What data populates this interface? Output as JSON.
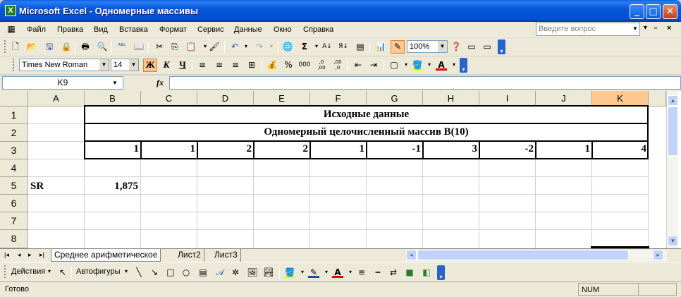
{
  "window": {
    "title": "Microsoft Excel - Одномерные массивы",
    "app_icon": "X"
  },
  "menu": {
    "items": [
      "Файл",
      "Правка",
      "Вид",
      "Вставка",
      "Формат",
      "Сервис",
      "Данные",
      "Окно",
      "Справка"
    ],
    "question_placeholder": "Введите вопрос"
  },
  "toolbar": {
    "zoom": "100%"
  },
  "format": {
    "font": "Times New Roman",
    "size": "14",
    "bold": "Ж",
    "italic": "К",
    "underline": "Ч",
    "percent": "%",
    "thousands": "000",
    "dec_inc": ",0 ,00",
    "dec_dec": ",00 ,0"
  },
  "formula_bar": {
    "name_box": "K9",
    "fx": "fx",
    "value": ""
  },
  "columns": [
    "A",
    "B",
    "C",
    "D",
    "E",
    "F",
    "G",
    "H",
    "I",
    "J",
    "K"
  ],
  "rows": [
    "1",
    "2",
    "3",
    "4",
    "5",
    "6",
    "7",
    "8"
  ],
  "cells": {
    "r1": "Исходные данные",
    "r2": "Одномерный целочисленный массив В(10)",
    "r3": [
      "1",
      "1",
      "2",
      "2",
      "1",
      "-1",
      "3",
      "-2",
      "1",
      "4"
    ],
    "a5": "SR",
    "b5": "1,875"
  },
  "sheets": {
    "tabs": [
      "Среднее арифметическое",
      "Лист2",
      "Лист3"
    ],
    "active": "Среднее арифметическое"
  },
  "drawing": {
    "actions": "Действия",
    "autoshapes": "Автофигуры"
  },
  "status": {
    "ready": "Готово",
    "num": "NUM"
  },
  "colors": {
    "title_blue": "#0054e3",
    "selection_orange": "#ffc890",
    "toolbar": "#ece9d8"
  }
}
